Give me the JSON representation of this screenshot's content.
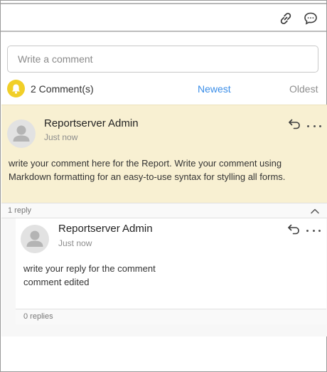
{
  "toolbar": {
    "link_icon": "link-icon",
    "comments_icon": "comments-icon"
  },
  "comment_box": {
    "placeholder": "Write a comment"
  },
  "summary": {
    "count_label": "2 Comment(s)",
    "sort_newest": "Newest",
    "sort_oldest": "Oldest",
    "bell_color": "#f1cf28",
    "active_sort_color": "#3b8ee8"
  },
  "comments": [
    {
      "author": "Reportserver Admin",
      "time": "Just now",
      "body": "write your comment here for the Report. Write your comment using Markdown formatting for an easy-to-use syntax for stylling all forms.",
      "highlight_color": "#f8f0d2",
      "replies_label": "1 reply",
      "replies": [
        {
          "author": "Reportserver Admin",
          "time": "Just now",
          "body_line1": "write your reply for the comment",
          "body_line2": "comment edited",
          "replies_label": "0 replies"
        }
      ]
    }
  ]
}
